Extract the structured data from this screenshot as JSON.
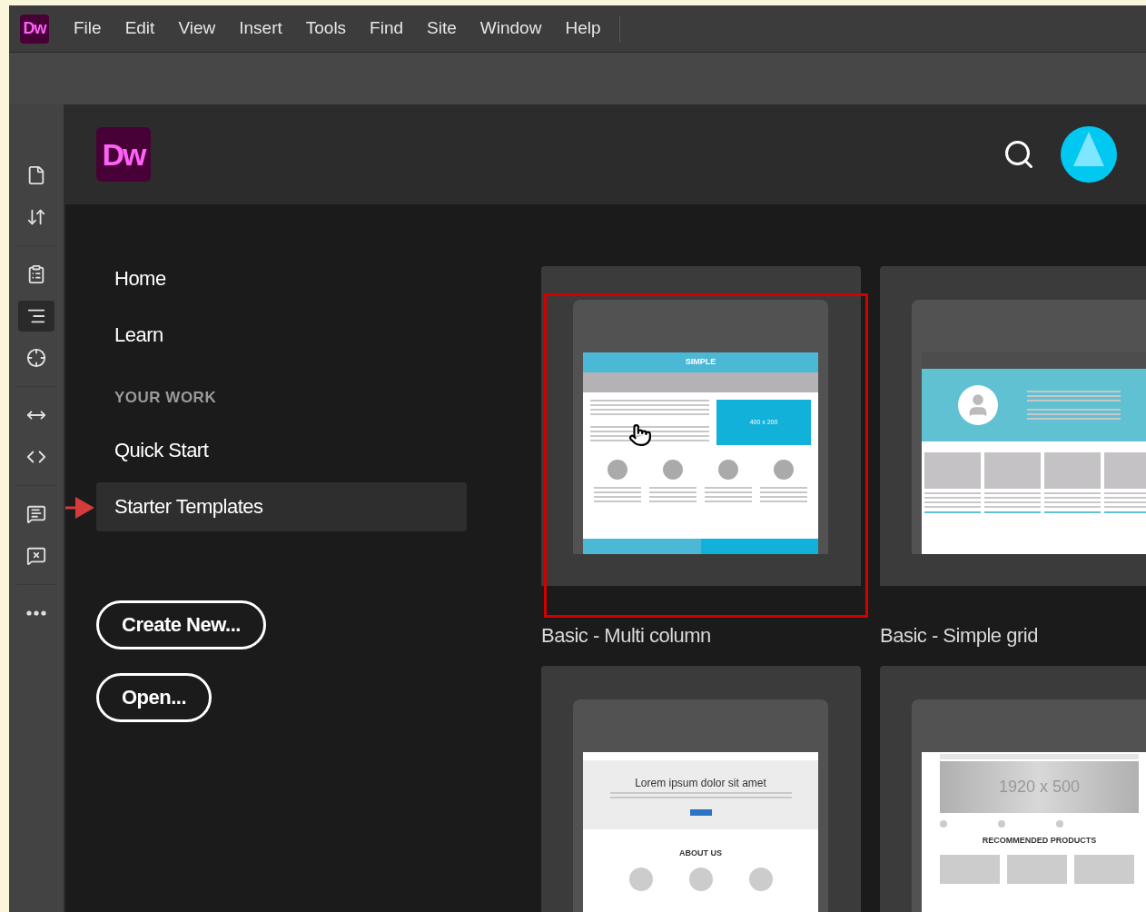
{
  "menu_bar": {
    "app_badge": "Dw",
    "items": [
      "File",
      "Edit",
      "View",
      "Insert",
      "Tools",
      "Find",
      "Site",
      "Window",
      "Help"
    ]
  },
  "tool_panel": {
    "tools": [
      {
        "selected": false
      },
      {
        "selected": false
      },
      {
        "selected": false
      },
      {
        "selected": true
      },
      {
        "selected": false
      },
      {
        "selected": false
      },
      {
        "selected": false
      },
      {
        "selected": false
      },
      {
        "selected": false
      },
      {
        "selected": false
      }
    ]
  },
  "header": {
    "logo": "Dw"
  },
  "nav": {
    "items": [
      {
        "kind": "link",
        "label": "Home",
        "selected": false,
        "annotated": false
      },
      {
        "kind": "link",
        "label": "Learn",
        "selected": false,
        "annotated": false
      },
      {
        "kind": "heading",
        "label": "YOUR WORK"
      },
      {
        "kind": "link",
        "label": "Quick Start",
        "selected": false,
        "annotated": false
      },
      {
        "kind": "link",
        "label": "Starter Templates",
        "selected": true,
        "annotated": true
      }
    ]
  },
  "buttons": [
    "Create New...",
    "Open..."
  ],
  "templates": [
    {
      "kind": "multi-column",
      "title": "Basic - Multi column",
      "highlighted": true,
      "texts": [
        "SIMPLE",
        "400 x 200"
      ]
    },
    {
      "kind": "simple-grid",
      "title": "Basic - Simple grid",
      "highlighted": false
    },
    {
      "kind": "hero",
      "highlighted": false,
      "texts": [
        "Lorem ipsum dolor sit amet",
        "ABOUT US"
      ]
    },
    {
      "kind": "shop",
      "highlighted": false,
      "texts": [
        "1920 x 500",
        "RECOMMENDED PRODUCTS"
      ]
    }
  ]
}
